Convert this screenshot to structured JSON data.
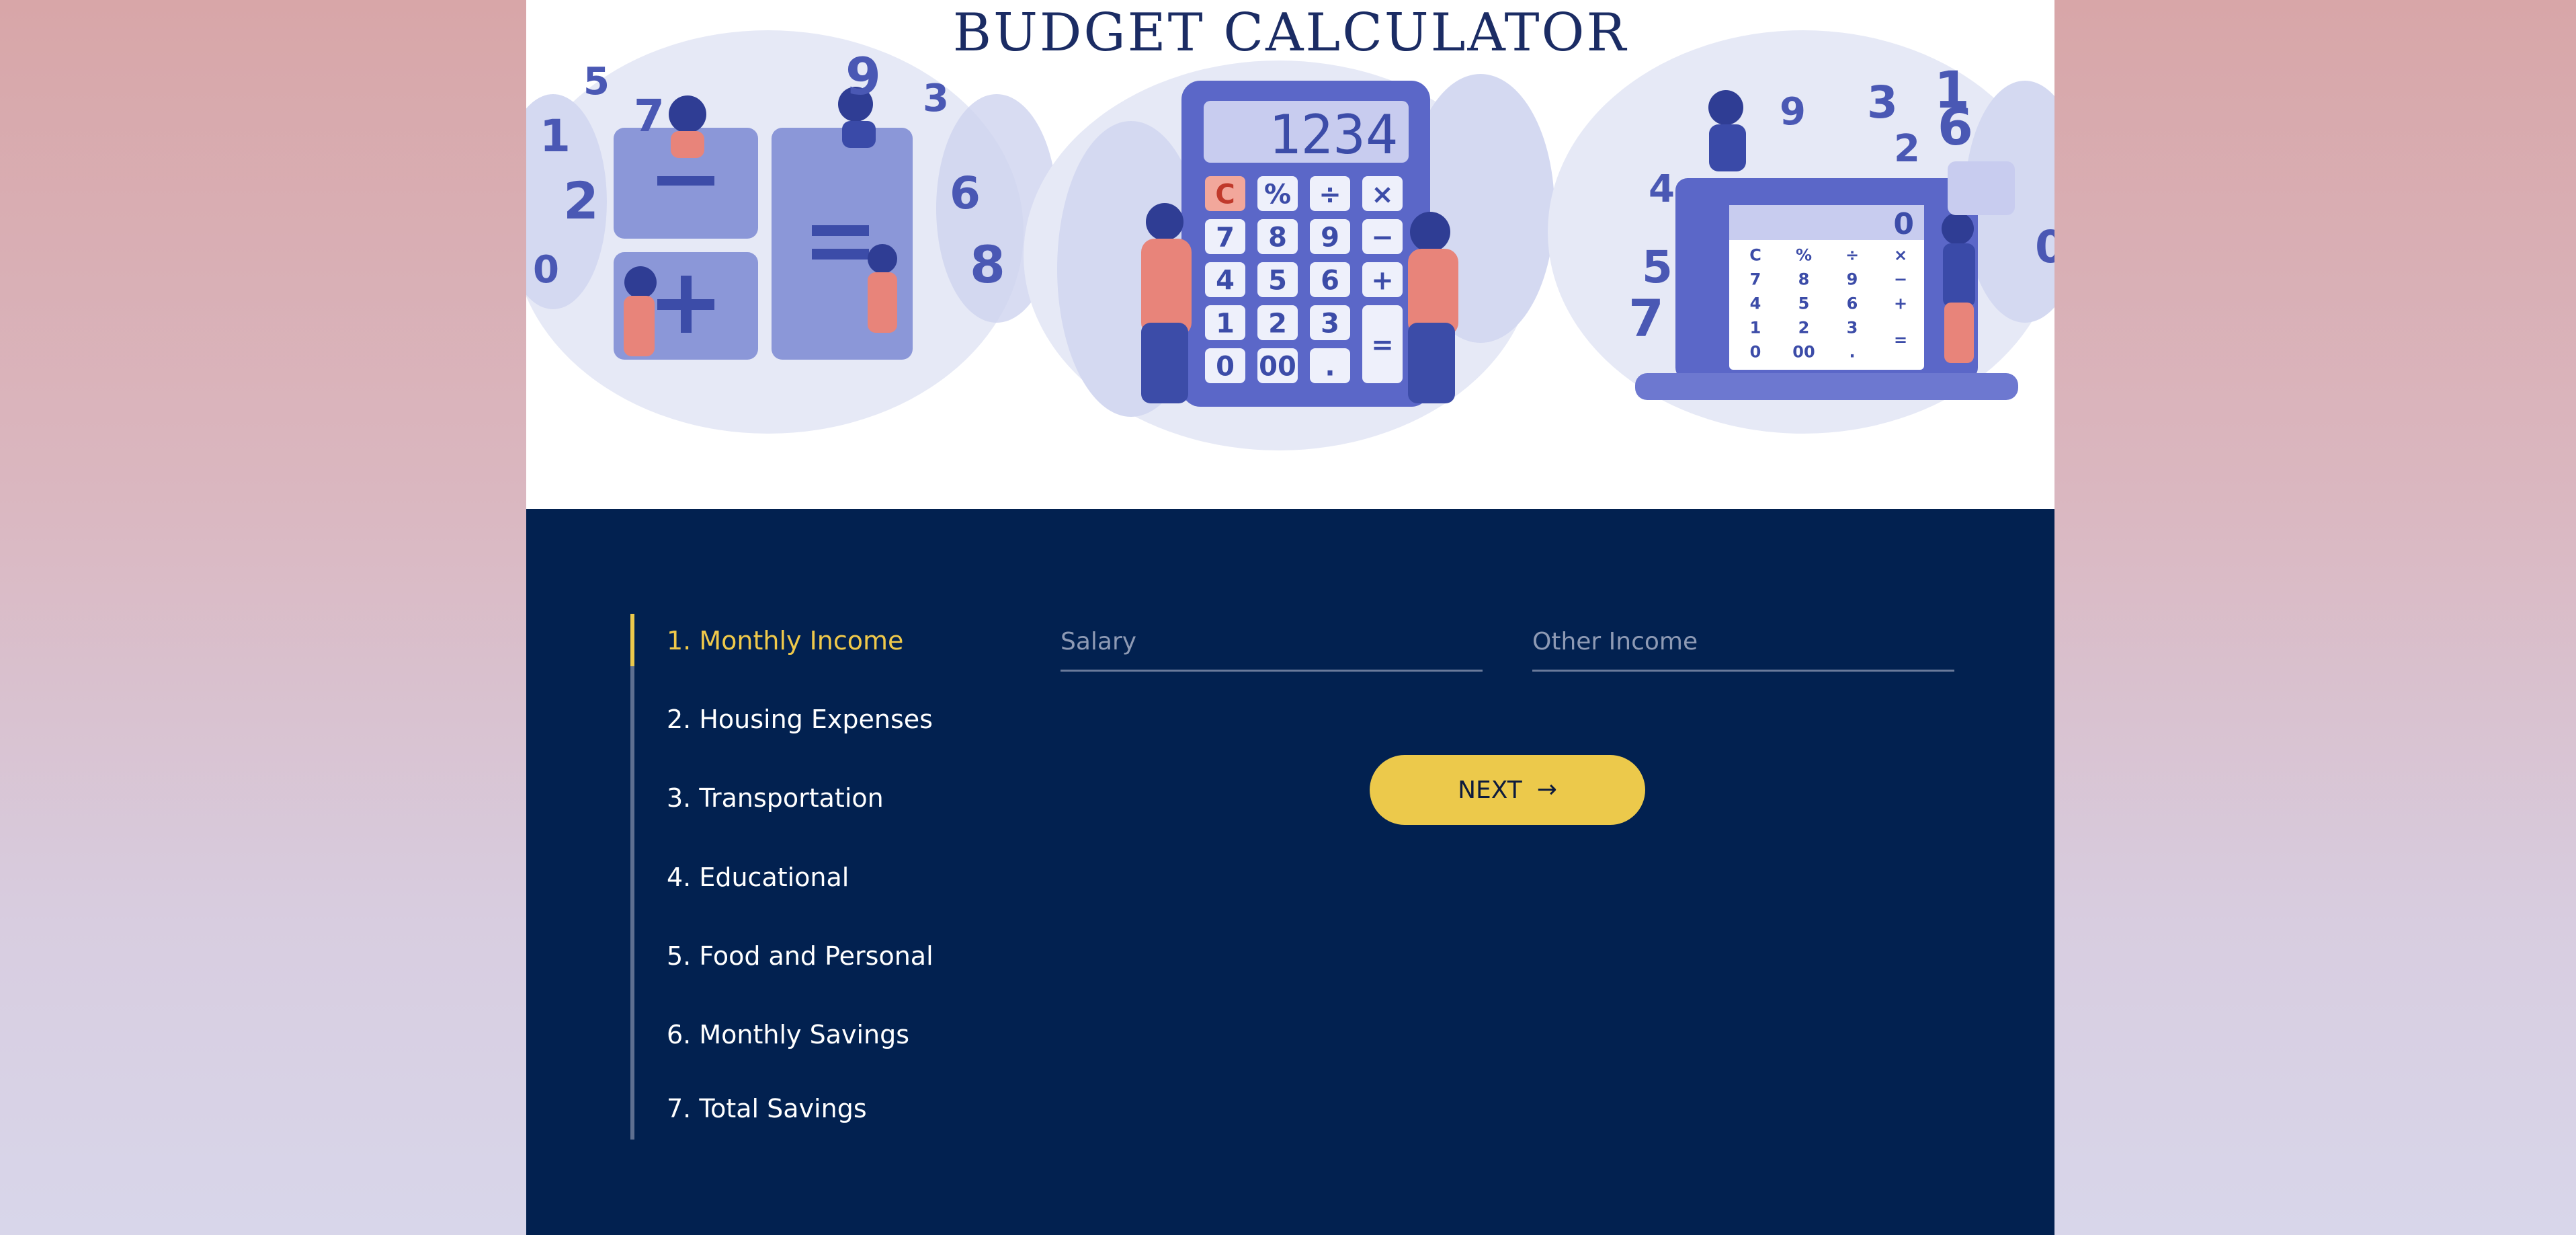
{
  "hero": {
    "title": "BUDGET CALCULATOR",
    "calculator_display": "1234",
    "laptop_display": "0",
    "keys": [
      "C",
      "%",
      "÷",
      "×",
      "7",
      "8",
      "9",
      "−",
      "4",
      "5",
      "6",
      "+",
      "1",
      "2",
      "3",
      "=",
      "0",
      "00",
      "."
    ],
    "floating_numbers": [
      "5",
      "7",
      "9",
      "3",
      "1",
      "2",
      "0",
      "6",
      "8",
      "4"
    ]
  },
  "steps": [
    {
      "label": "1. Monthly Income",
      "active": true
    },
    {
      "label": "2. Housing Expenses",
      "active": false
    },
    {
      "label": "3. Transportation",
      "active": false
    },
    {
      "label": "4. Educational",
      "active": false
    },
    {
      "label": "5. Food and Personal",
      "active": false
    },
    {
      "label": "6. Monthly Savings",
      "active": false
    },
    {
      "label": "7. Total Savings",
      "active": false
    }
  ],
  "form": {
    "salary_placeholder": "Salary",
    "salary_value": "",
    "other_income_placeholder": "Other Income",
    "other_income_value": "",
    "next_label": "NEXT",
    "next_icon": "arrow-right-icon"
  },
  "colors": {
    "panel": "#022150",
    "accent": "#ecc94b",
    "title": "#1b2c64"
  }
}
